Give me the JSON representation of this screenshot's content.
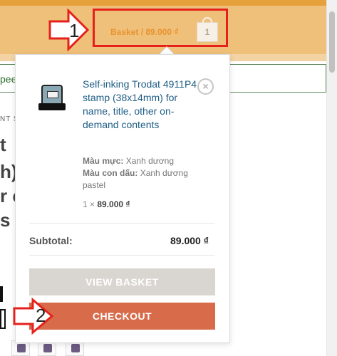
{
  "header": {
    "basket_label": "Basket",
    "basket_separator": " / ",
    "basket_total": "89.000 ₫",
    "basket_count": "1"
  },
  "annotations": {
    "step1": "1",
    "step2": "2"
  },
  "background": {
    "notice_text": "pee",
    "small_text": "NT S",
    "title_lines": [
      "t",
      "h)",
      "r c",
      "s"
    ]
  },
  "mini_cart": {
    "product_name": "Self-inking Trodat 4911P4 stamp (38x14mm) for name, title, other on-demand contents",
    "remove_symbol": "×",
    "variations": [
      {
        "label": "Màu mực:",
        "value": "Xanh dương"
      },
      {
        "label": "Màu con dấu:",
        "value": "Xanh dương pastel"
      }
    ],
    "quantity_prefix": "1 × ",
    "item_price": "89.000 ₫",
    "subtotal_label": "Subtotal:",
    "subtotal_value": "89.000 ₫",
    "view_basket_label": "VIEW BASKET",
    "checkout_label": "CHECKOUT"
  },
  "colors": {
    "header": "#efc07a",
    "annotation_red": "#e4221b",
    "checkout_button": "#d86b4a",
    "view_basket_button": "#d9d6d1",
    "product_link": "#1f5d86"
  }
}
